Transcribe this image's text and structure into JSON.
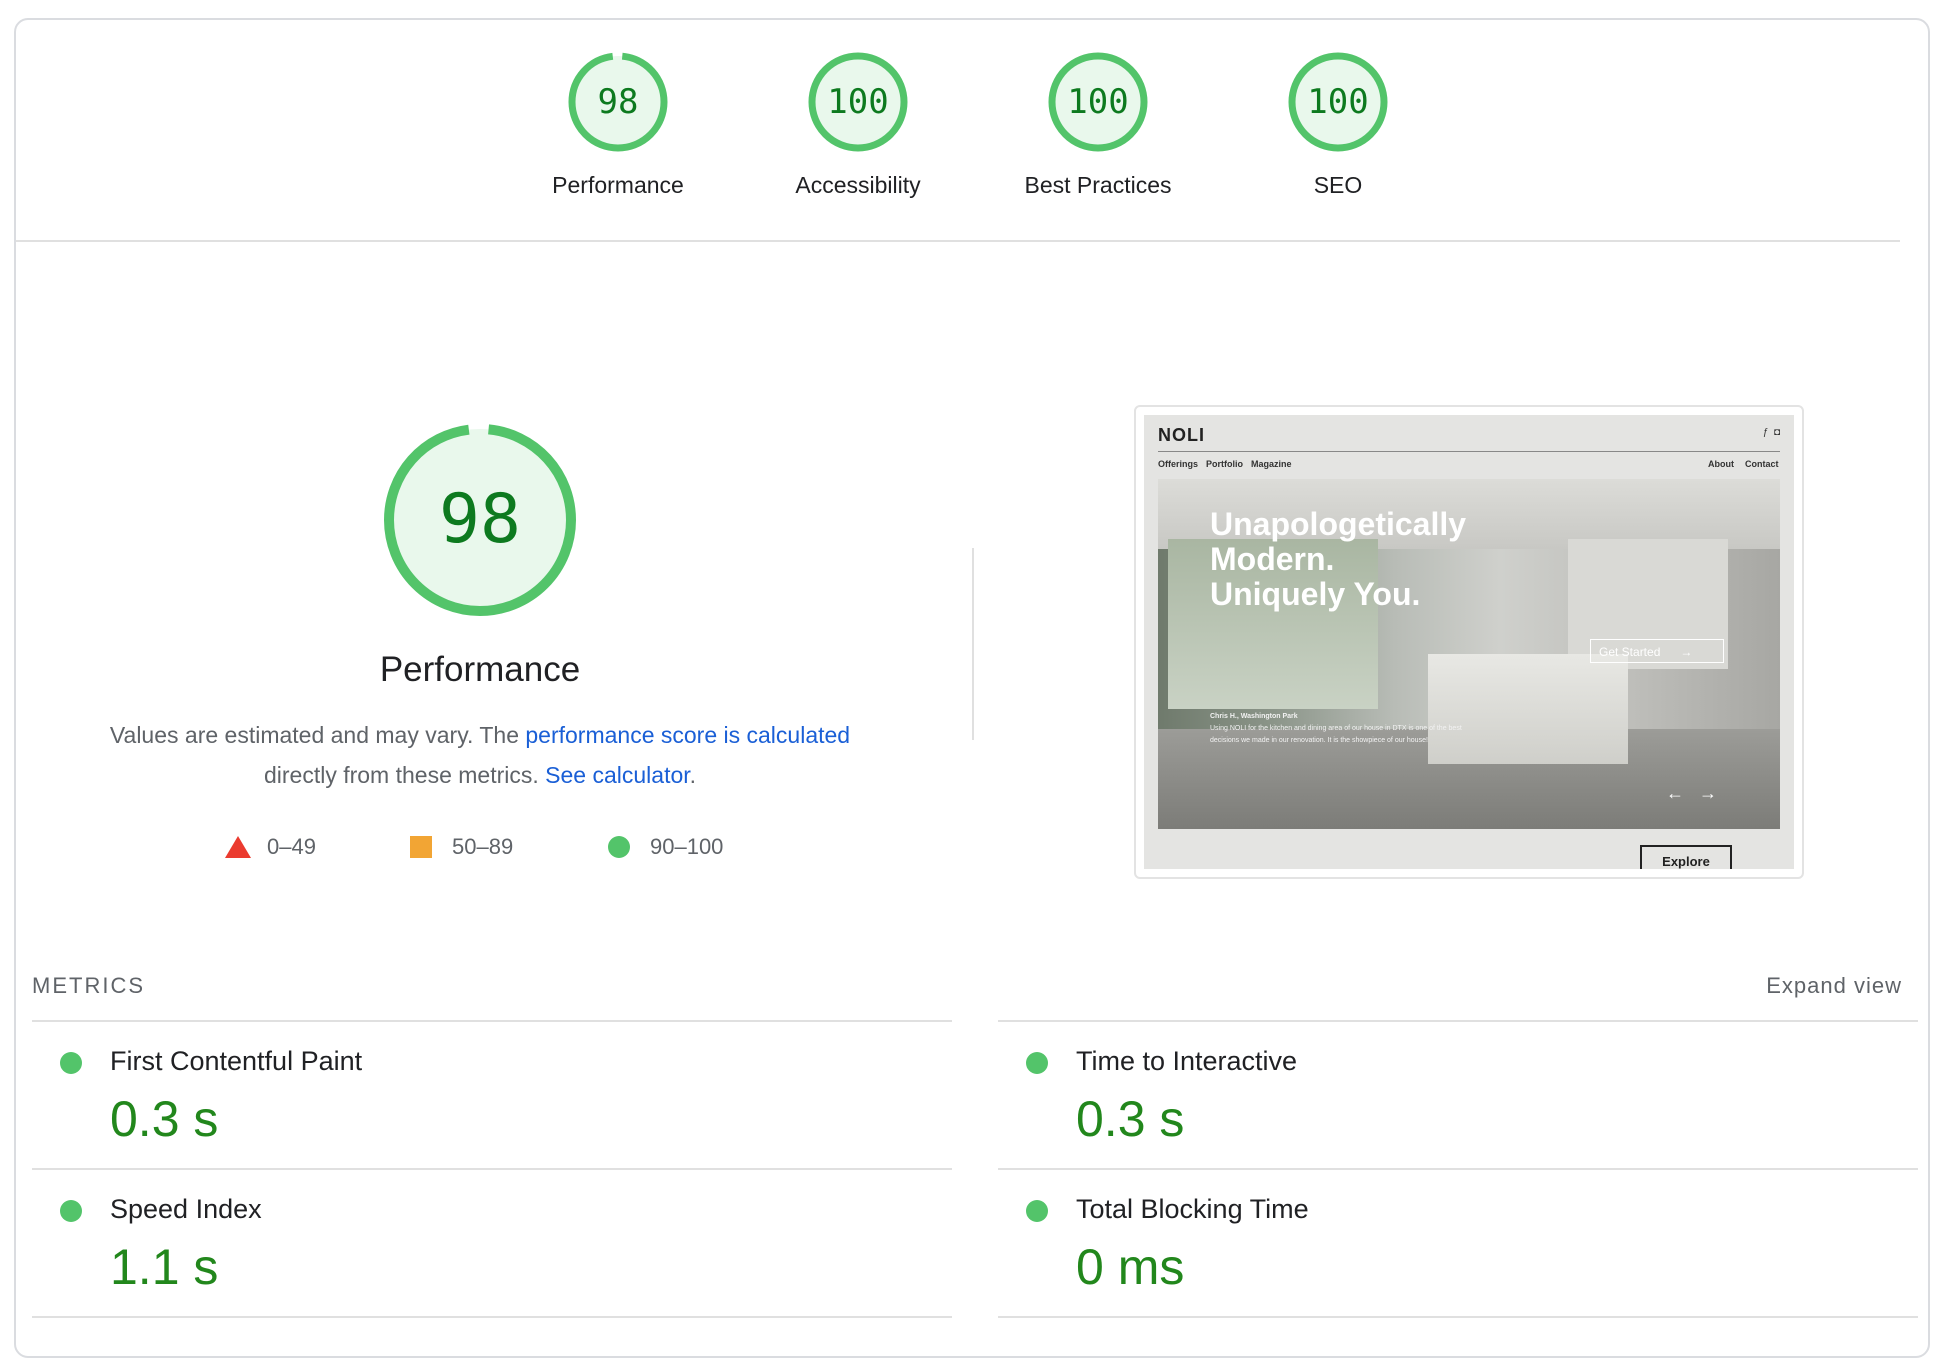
{
  "colors": {
    "pass": "#53c46a",
    "pass_text": "#0d7a1f",
    "average": "#f2a534",
    "fail": "#eb3b2f",
    "link": "#1a5fd6"
  },
  "categories": [
    {
      "label": "Performance",
      "score": "98",
      "fraction": 0.98
    },
    {
      "label": "Accessibility",
      "score": "100",
      "fraction": 1.0
    },
    {
      "label": "Best Practices",
      "score": "100",
      "fraction": 1.0
    },
    {
      "label": "SEO",
      "score": "100",
      "fraction": 1.0
    }
  ],
  "main": {
    "score": "98",
    "fraction": 0.98,
    "title": "Performance",
    "desc_prefix": "Values are estimated and may vary. The ",
    "desc_link1": "performance score is calculated",
    "desc_mid": " directly from these metrics. ",
    "desc_link2": "See calculator",
    "desc_end": ".",
    "legend": [
      {
        "icon": "red-triangle-icon",
        "range": "0–49"
      },
      {
        "icon": "orange-square-icon",
        "range": "50–89"
      },
      {
        "icon": "green-circle-icon",
        "range": "90–100"
      }
    ]
  },
  "thumbnail": {
    "logo": "NOLI",
    "nav_left": [
      "Offerings",
      "Portfolio",
      "Magazine"
    ],
    "nav_right": [
      "About",
      "Contact"
    ],
    "headline": [
      "Unapologetically",
      "Modern.",
      "Uniquely You."
    ],
    "cta": "Get Started",
    "quote_author": "Chris H., Washington Park",
    "quote_text": "Using NOLI for the kitchen and dining area of our house in DTX is one of the best decisions we made in our renovation. It is the showpiece of our house!",
    "explore": "Explore"
  },
  "metrics": {
    "title": "METRICS",
    "expand": "Expand view",
    "items": [
      {
        "name": "First Contentful Paint",
        "value": "0.3 s"
      },
      {
        "name": "Time to Interactive",
        "value": "0.3 s"
      },
      {
        "name": "Speed Index",
        "value": "1.1 s"
      },
      {
        "name": "Total Blocking Time",
        "value": "0 ms"
      }
    ]
  }
}
